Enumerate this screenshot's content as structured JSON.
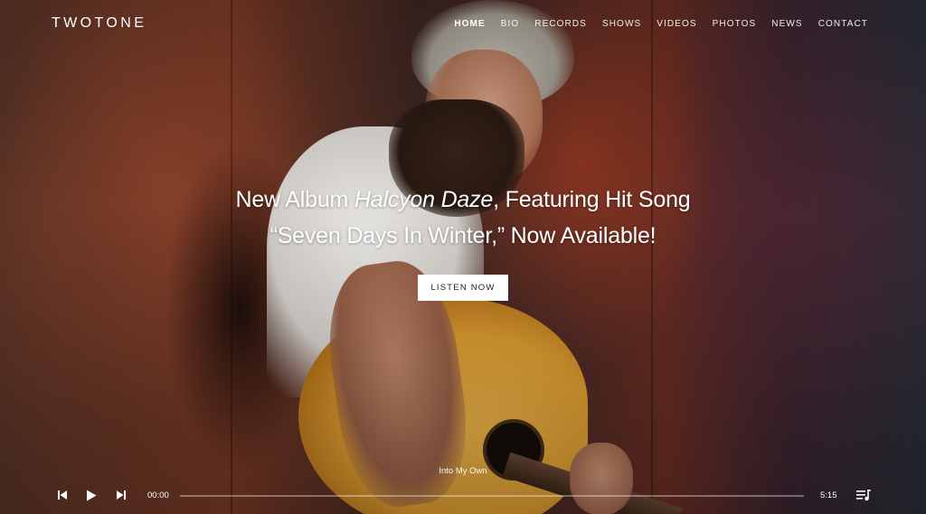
{
  "brand": {
    "logo": "TWOTONE"
  },
  "nav": {
    "items": [
      {
        "label": "HOME",
        "active": true
      },
      {
        "label": "BIO",
        "active": false
      },
      {
        "label": "RECORDS",
        "active": false
      },
      {
        "label": "SHOWS",
        "active": false
      },
      {
        "label": "VIDEOS",
        "active": false
      },
      {
        "label": "PHOTOS",
        "active": false
      },
      {
        "label": "NEWS",
        "active": false
      },
      {
        "label": "CONTACT",
        "active": false
      }
    ]
  },
  "hero": {
    "line1_prefix": "New Album ",
    "line1_album": "Halcyon Daze",
    "line1_suffix": ", Featuring Hit Song",
    "line2": "“Seven Days In Winter,” Now Available!",
    "cta_label": "LISTEN NOW"
  },
  "player": {
    "track_title": "Into My Own",
    "current_time": "00:00",
    "duration": "5:15",
    "progress": 0,
    "icons": [
      "previous-icon",
      "play-icon",
      "next-icon",
      "playlist-icon"
    ]
  },
  "colors": {
    "text": "#ffffff",
    "button_bg": "#ffffff",
    "button_text": "#222222"
  }
}
